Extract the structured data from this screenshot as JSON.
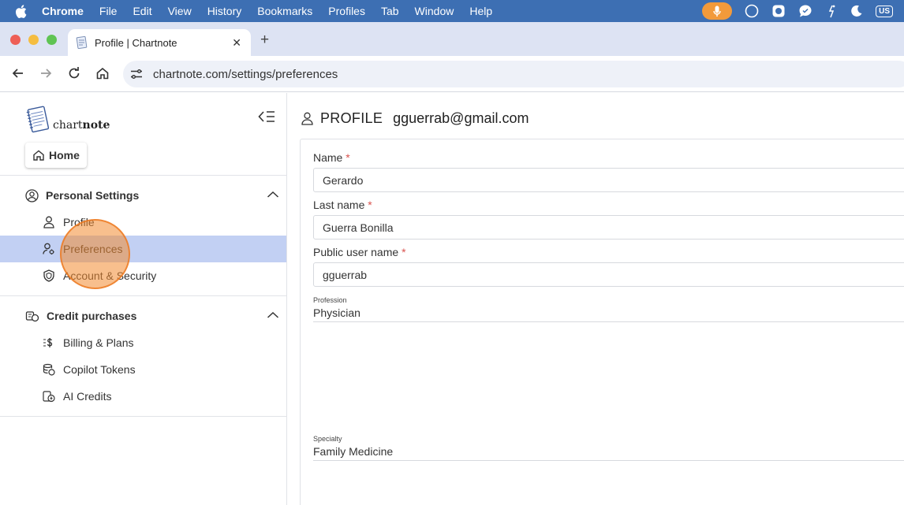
{
  "menubar": {
    "items": [
      "Chrome",
      "File",
      "Edit",
      "View",
      "History",
      "Bookmarks",
      "Profiles",
      "Tab",
      "Window",
      "Help"
    ],
    "status_icons": [
      "microphone-icon",
      "circle-icon",
      "box-icon",
      "chat-icon",
      "accessibility-icon",
      "moon-icon"
    ],
    "input_badge": "US",
    "accent_color": "#f29a3b"
  },
  "browser": {
    "tab_title": "Profile | Chartnote",
    "new_tab": "+",
    "close": "✕",
    "url": "chartnote.com/settings/preferences"
  },
  "sidebar": {
    "logo_text_regular": "chart",
    "logo_text_bold": "note",
    "home_label": "Home",
    "sections": [
      {
        "label": "Personal Settings",
        "items": [
          {
            "label": "Profile",
            "icon": "person-icon"
          },
          {
            "label": "Preferences",
            "icon": "preferences-person-icon",
            "active": true
          },
          {
            "label": "Account & Security",
            "icon": "shield-icon"
          }
        ]
      },
      {
        "label": "Credit purchases",
        "items": [
          {
            "label": "Billing & Plans",
            "icon": "billing-icon"
          },
          {
            "label": "Copilot Tokens",
            "icon": "tokens-icon"
          },
          {
            "label": "AI Credits",
            "icon": "credits-icon"
          }
        ]
      }
    ],
    "active_color": "#c2d0f3"
  },
  "main": {
    "header_label": "PROFILE",
    "header_email": "gguerrab@gmail.com",
    "fields": {
      "name": {
        "label": "Name",
        "required": "*",
        "value": "Gerardo"
      },
      "last_name": {
        "label": "Last name",
        "required": "*",
        "value": "Guerra Bonilla"
      },
      "public_user_name": {
        "label": "Public user name",
        "required": "*",
        "value": "gguerrab"
      },
      "profession": {
        "label": "Profession",
        "value": "Physician"
      },
      "specialty": {
        "label": "Specialty",
        "value": "Family Medicine"
      }
    }
  }
}
